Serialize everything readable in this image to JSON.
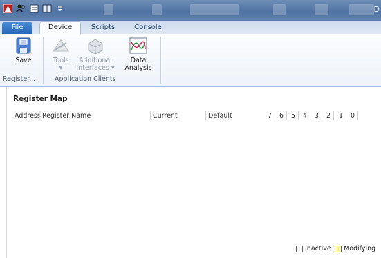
{
  "window": {
    "title": "D"
  },
  "tabs": {
    "file": "File",
    "device": "Device",
    "scripts": "Scripts",
    "console": "Console"
  },
  "ribbon": {
    "save": {
      "line1": "Save",
      "line2": ""
    },
    "tools": {
      "line1": "Tools",
      "line2": "▾"
    },
    "additional_interfaces": {
      "line1": "Additional",
      "line2": "Interfaces ▾"
    },
    "data_analysis": {
      "line1": "Data",
      "line2": "Analysis"
    },
    "groups": {
      "register": "Register...",
      "application_clients": "Application Clients"
    }
  },
  "register_map": {
    "heading": "Register Map",
    "columns": {
      "address": "Address",
      "register_name": "Register Name",
      "current": "Current",
      "default": "Default",
      "bits": [
        "7",
        "6",
        "5",
        "4",
        "3",
        "2",
        "1",
        "0"
      ]
    }
  },
  "legend": {
    "inactive": {
      "label": "Inactive",
      "color": "#ffffff"
    },
    "modifying": {
      "label": "Modifying",
      "color": "#fff7b0"
    }
  },
  "colors": {
    "title_bar": "#4f73a3",
    "file_tab": "#2a66b8",
    "ribbon_bg": "#f3f6fb"
  }
}
